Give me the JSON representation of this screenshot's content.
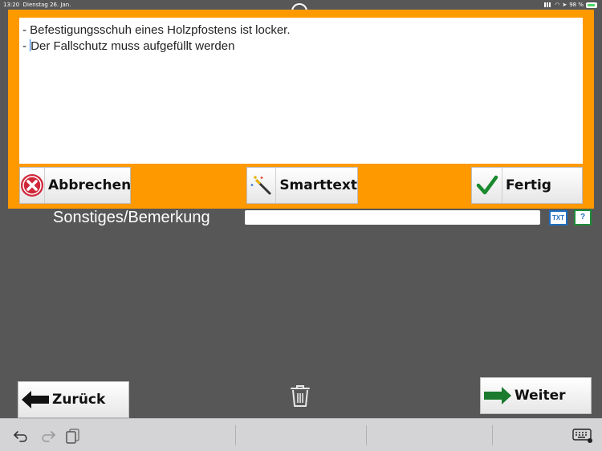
{
  "status_bar": {
    "time": "13:20",
    "date": "Dienstag 26. Jan.",
    "battery": "98 %"
  },
  "background": {
    "remarks_label": "Sonstiges/Bemerkung",
    "txt_button": "TXT",
    "help_button": "?"
  },
  "dialog": {
    "lines": [
      "- Befestigungsschuh eines Holzpfostens ist locker.",
      "- Der Fallschutz muss aufgefüllt werden"
    ],
    "line2_prefix": "- ",
    "line2_text": "Der Fallschutz muss aufgefüllt werden",
    "cancel_label": "Abbrechen",
    "smarttext_label": "Smarttext",
    "done_label": "Fertig"
  },
  "navigation": {
    "back_label": "Zurück",
    "next_label": "Weiter"
  },
  "colors": {
    "dialog_bg": "#ff9900",
    "page_bg": "#575757",
    "cancel_red": "#d0273a",
    "done_green": "#1a8a2e",
    "next_arrow_green": "#1a7a2e"
  }
}
